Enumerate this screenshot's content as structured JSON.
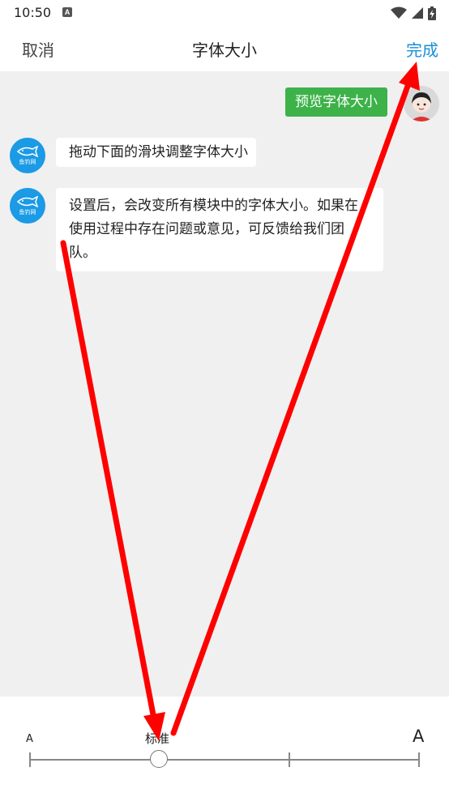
{
  "status_bar": {
    "time": "10:50"
  },
  "header": {
    "cancel_label": "取消",
    "title": "字体大小",
    "done_label": "完成"
  },
  "chat": {
    "user_message": "预览字体大小",
    "bot_messages": [
      "拖动下面的滑块调整字体大小",
      "设置后，会改变所有模块中的字体大小。如果在使用过程中存在问题或意见，可反馈给我们团队。"
    ],
    "bot_avatar_label": "鱼钓网"
  },
  "font_slider": {
    "small_label": "A",
    "standard_label": "标准",
    "large_label": "A",
    "steps": 4,
    "selected_index": 1
  },
  "colors": {
    "accent": "#1a8fd8",
    "user_bubble": "#3db249",
    "annotation_arrow": "#ff0000"
  }
}
